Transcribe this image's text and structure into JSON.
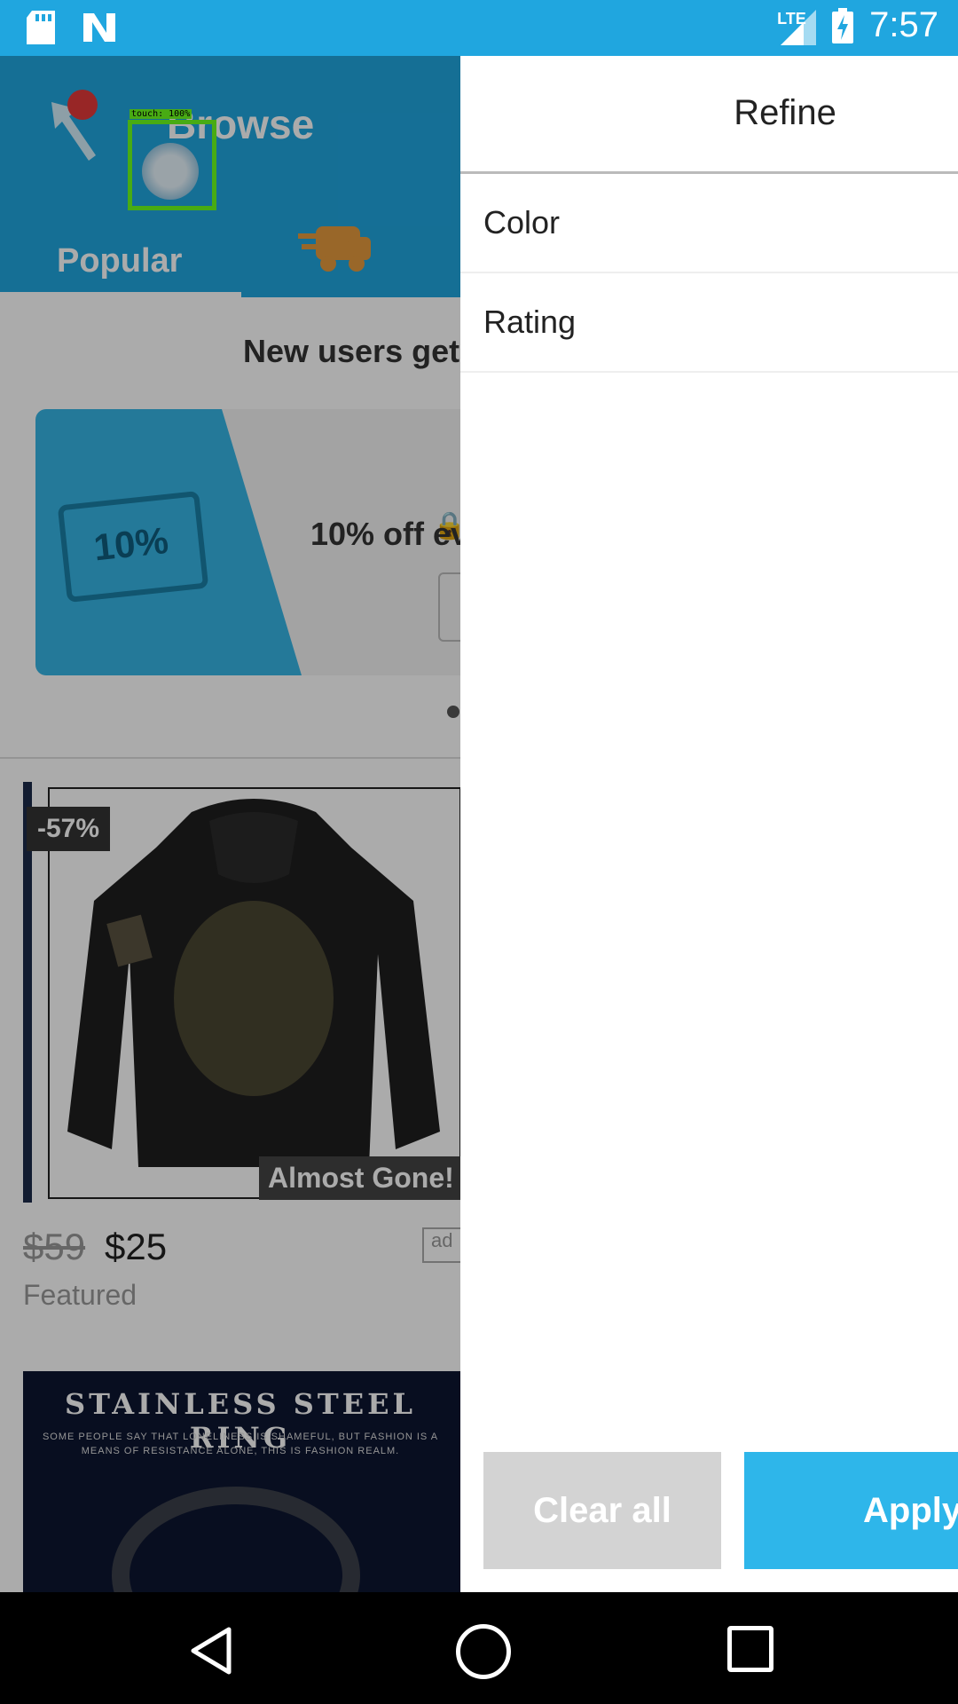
{
  "status_bar": {
    "time": "7:57",
    "network": "LTE",
    "icons": [
      "sd-card-icon",
      "notification-n-icon",
      "signal-icon",
      "battery-charging-icon"
    ]
  },
  "header": {
    "title": "Browse",
    "tabs": [
      {
        "label": "Popular",
        "selected": true
      },
      {
        "icon": "delivery-truck-icon"
      }
    ]
  },
  "touch_overlay": {
    "label": "touch: 100%"
  },
  "promo": {
    "banner_text": "New users get",
    "coupon_badge": "10%",
    "coupon_text": "10% off ev"
  },
  "products": [
    {
      "discount": "-57%",
      "badge": "Almost Gone!",
      "old_price": "$59",
      "price": "$25",
      "tag": "ad",
      "label": "Featured"
    },
    {
      "title": "STAINLESS STEEL RING",
      "subtitle": "SOME PEOPLE SAY THAT LONELINESS IS SHAMEFUL, BUT FASHION IS A MEANS OF RESISTANCE ALONE, THIS IS FASHION REALM."
    }
  ],
  "drawer": {
    "title": "Refine",
    "filters": [
      "Color",
      "Rating"
    ],
    "clear_label": "Clear all",
    "apply_label": "Apply"
  },
  "colors": {
    "accent": "#20a6df",
    "apply": "#2eb6ea",
    "clear": "#d3d3d3"
  }
}
